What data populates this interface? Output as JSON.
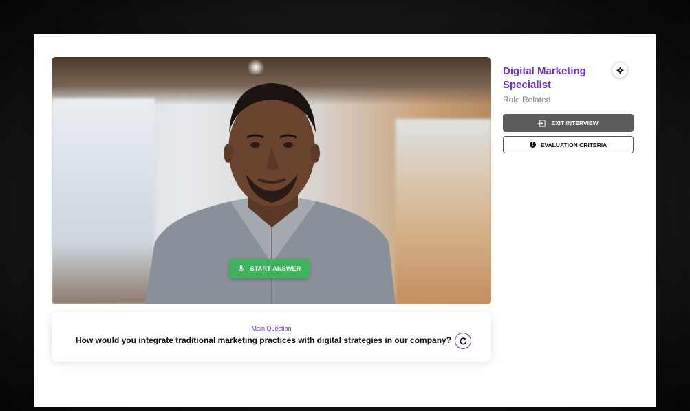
{
  "interview": {
    "role_title": "Digital Marketing Specialist",
    "role_category": "Role Related"
  },
  "actions": {
    "exit_label": "EXIT INTERVIEW",
    "evaluation_label": "EVALUATION CRITERIA",
    "start_answer_label": "START ANSWER"
  },
  "question": {
    "kicker": "Main Question",
    "text": "How would you integrate traditional marketing practices with digital strategies in our company?"
  },
  "icons": {
    "settings": "gear-icon",
    "exit": "exit-icon",
    "info": "info-icon",
    "microphone": "microphone-icon",
    "refresh": "refresh-icon"
  },
  "colors": {
    "accent": "#6d2fd3",
    "start_button": "#3fb35b",
    "exit_button": "#5c5c5c"
  }
}
